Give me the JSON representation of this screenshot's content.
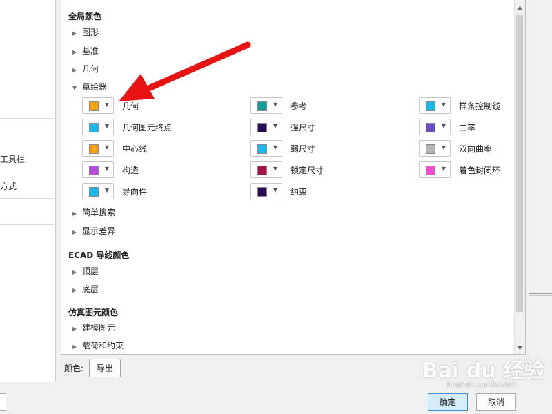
{
  "left_panel": {
    "item1": "工具栏",
    "item2": "方式"
  },
  "sections": {
    "global": {
      "title": "全局颜色",
      "items": [
        "图形",
        "基准",
        "几何"
      ],
      "sketcher": "草绘器",
      "after": [
        "简单搜索",
        "显示差异"
      ]
    },
    "ecad": {
      "title": "ECAD 导线颜色",
      "items": [
        "顶层",
        "底层"
      ]
    },
    "sim": {
      "title": "仿真图元颜色",
      "items": [
        "建模图元",
        "载荷和约束"
      ]
    }
  },
  "swatches": [
    {
      "label": "几何",
      "color": "#f5a313"
    },
    {
      "label": "参考",
      "color": "#0e9e96"
    },
    {
      "label": "样条控制线",
      "color": "#19b8e6"
    },
    {
      "label": "几何图元终点",
      "color": "#19b8e6"
    },
    {
      "label": "强尺寸",
      "color": "#2a0a55"
    },
    {
      "label": "曲率",
      "color": "#6c4bc1"
    },
    {
      "label": "中心线",
      "color": "#f5a313"
    },
    {
      "label": "弱尺寸",
      "color": "#19b8e6"
    },
    {
      "label": "双向曲率",
      "color": "#b3b3b3"
    },
    {
      "label": "构造",
      "color": "#b44fd6"
    },
    {
      "label": "锁定尺寸",
      "color": "#a3154a"
    },
    {
      "label": "着色封闭环",
      "color": "#f24fd2"
    },
    {
      "label": "导向件",
      "color": "#19b8e6"
    },
    {
      "label": "约束",
      "color": "#2a0a55"
    }
  ],
  "bottom": {
    "label": "颜色:",
    "export_button": "导出"
  },
  "footer": {
    "ok": "确定",
    "cancel": "取消"
  },
  "watermark": {
    "main": "Bai du 经验",
    "sub": "jingyan.baidu.com"
  },
  "arrow_color": "#e81414"
}
